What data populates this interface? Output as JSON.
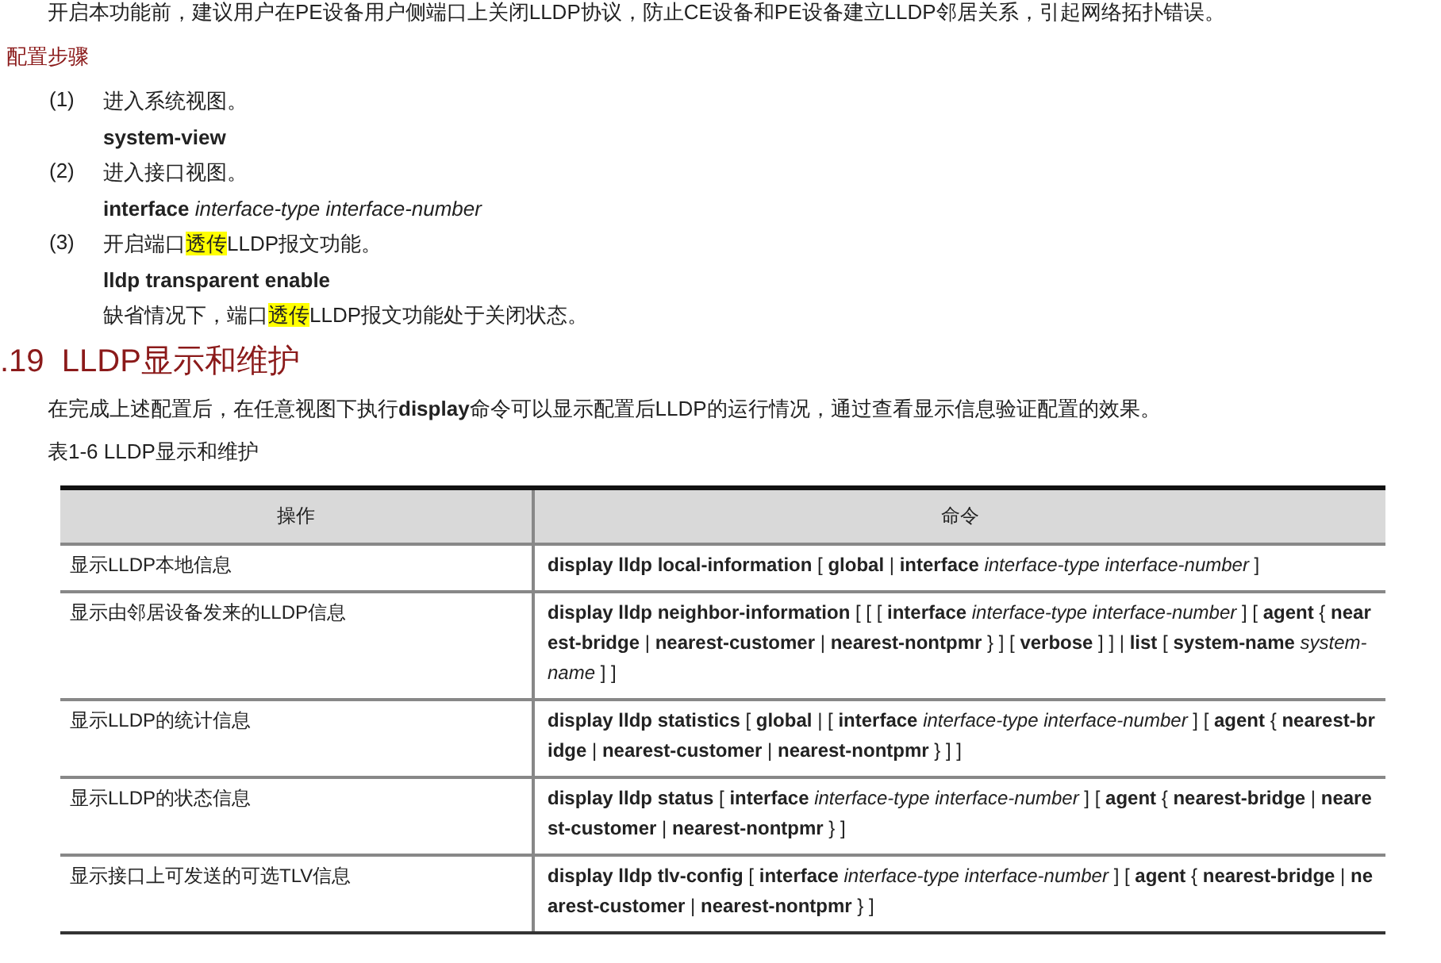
{
  "intro": "开启本功能前，建议用户在PE设备用户侧端口上关闭LLDP协议，防止CE设备和PE设备建立LLDP邻居关系，引起网络拓扑错误。",
  "steps_title": "配置步骤",
  "steps": [
    {
      "number": "(1)",
      "text": [
        {
          "text": "进入系统视图。",
          "highlighted": false
        }
      ],
      "command": "**system-view**"
    },
    {
      "number": "(2)",
      "text": [
        {
          "text": "进入接口视图。",
          "highlighted": false
        }
      ],
      "command": "**interface** *interface-type interface-number*"
    },
    {
      "number": "(3)",
      "text": [
        {
          "text": "开启端口",
          "highlighted": false
        },
        {
          "text": "透传",
          "highlighted": true
        },
        {
          "text": "LLDP报文功能。",
          "highlighted": false
        }
      ],
      "command": "**lldp transparent enable**",
      "note": [
        {
          "text": "缺省情况下，端口",
          "highlighted": false
        },
        {
          "text": "透传",
          "highlighted": true
        },
        {
          "text": "LLDP报文功能处于关闭状态。",
          "highlighted": false
        }
      ]
    }
  ],
  "section_heading": ".19  LLDP显示和维护",
  "section_text": "在完成上述配置后，在任意视图下执行**display**命令可以显示配置后LLDP的运行情况，通过查看显示信息验证配置的效果。",
  "table_caption": "表1-6 LLDP显示和维护",
  "table": {
    "columns": [
      "操作",
      "命令"
    ],
    "rows": [
      {
        "operation": "显示LLDP本地信息",
        "command": "**display lldp local-information** [ **global** | **interface** *interface-type interface-number* ]"
      },
      {
        "operation": "显示由邻居设备发来的LLDP信息",
        "command": "**display lldp neighbor-information** [ [ [ **interface** *interface-type interface-number* ] [ **agent** { **nearest-bridge** | **nearest-customer** | **nearest-nontpmr** } ] [ **verbose** ] ] | **list** [ **system-name** *system-name* ] ]"
      },
      {
        "operation": "显示LLDP的统计信息",
        "command": "**display lldp statistics** [ **global** | [ **interface** *interface-type interface-number* ] [ **agent** { **nearest-bridge** | **nearest-customer** | **nearest-nontpmr** } ] ]"
      },
      {
        "operation": "显示LLDP的状态信息",
        "command": "**display lldp status** [ **interface** *interface-type interface-number* ] [ **agent** { **nearest-bridge** | **nearest-customer** | **nearest-nontpmr** } ]"
      },
      {
        "operation": "显示接口上可发送的可选TLV信息",
        "command": "**display lldp tlv-config** [ **interface** *interface-type interface-number* ] [ **agent** { **nearest-bridge** | **nearest-customer** | **nearest-nontpmr** } ]"
      }
    ]
  }
}
